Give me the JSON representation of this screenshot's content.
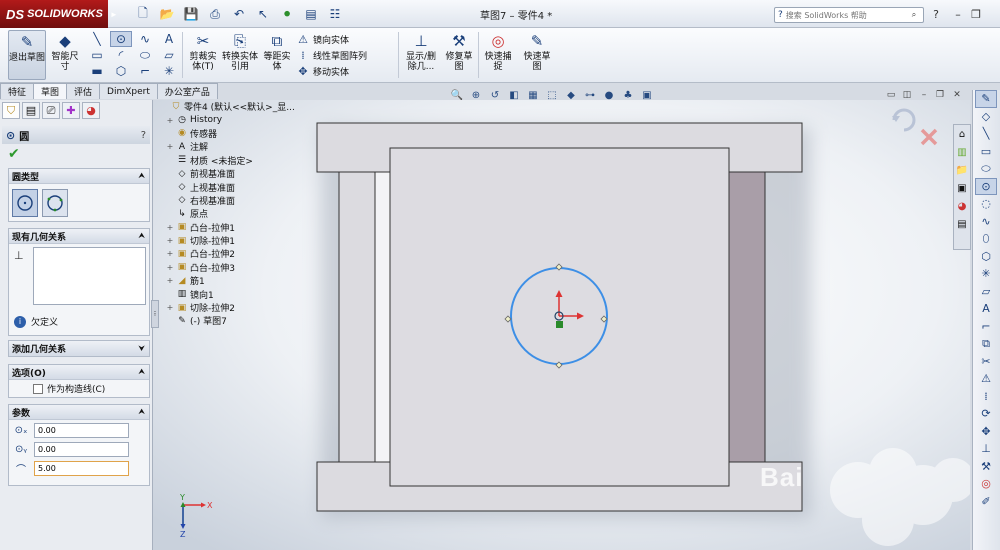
{
  "app": {
    "brand_mark": "DS",
    "name": "SOLIDWORKS",
    "doc_title": "草图7 – 零件4 *"
  },
  "search": {
    "placeholder": "搜索 SolidWorks 帮助"
  },
  "cmd": {
    "exit_sketch": "退出草图",
    "smart_dim": "智能尺寸",
    "trim": "剪裁实体(T)",
    "convert": "转换实体引用",
    "offset": "等距实体",
    "mirror": "镜向实体",
    "linear_pattern": "线性草图阵列",
    "move": "移动实体",
    "display_delete": "显示/删除几...",
    "repair": "修复草图",
    "quick_snaps": "快速捕捉",
    "rapid_sketch": "快速草图"
  },
  "tabs": [
    "特征",
    "草图",
    "评估",
    "DimXpert",
    "办公室产品"
  ],
  "active_tab": 1,
  "panel": {
    "title": "圆",
    "group_type": "圆类型",
    "group_existing": "现有几何关系",
    "status": "欠定义",
    "group_add": "添加几何关系",
    "group_options": "选项(O)",
    "construction": "作为构造线(C)",
    "group_params": "参数",
    "cx": "0.00",
    "cy": "0.00",
    "radius": "5.00"
  },
  "tree": [
    {
      "label": "零件4  (默认<<默认>_显...",
      "icon": "part-icon",
      "expand": ""
    },
    {
      "label": "History",
      "icon": "history-icon",
      "expand": "+"
    },
    {
      "label": "传感器",
      "icon": "sensor-icon",
      "expand": ""
    },
    {
      "label": "注解",
      "icon": "annotation-icon",
      "expand": "+"
    },
    {
      "label": "材质 <未指定>",
      "icon": "material-icon",
      "expand": ""
    },
    {
      "label": "前视基准面",
      "icon": "plane-icon",
      "expand": ""
    },
    {
      "label": "上视基准面",
      "icon": "plane-icon",
      "expand": ""
    },
    {
      "label": "右视基准面",
      "icon": "plane-icon",
      "expand": ""
    },
    {
      "label": "原点",
      "icon": "origin-icon",
      "expand": ""
    },
    {
      "label": "凸台-拉伸1",
      "icon": "boss-extrude-icon",
      "expand": "+"
    },
    {
      "label": "切除-拉伸1",
      "icon": "cut-extrude-icon",
      "expand": "+"
    },
    {
      "label": "凸台-拉伸2",
      "icon": "boss-extrude-icon",
      "expand": "+"
    },
    {
      "label": "凸台-拉伸3",
      "icon": "boss-extrude-icon",
      "expand": "+"
    },
    {
      "label": "筋1",
      "icon": "rib-icon",
      "expand": "+"
    },
    {
      "label": "镜向1",
      "icon": "mirror-icon",
      "expand": ""
    },
    {
      "label": "切除-拉伸2",
      "icon": "cut-extrude-icon",
      "expand": "+"
    },
    {
      "label": "(-) 草图7",
      "icon": "sketch-icon",
      "expand": ""
    }
  ],
  "triad": {
    "x": "X",
    "y": "Y",
    "z": "Z"
  },
  "watermark": "Bai",
  "colors": {
    "circle": "#3d8fe6",
    "accent": "#1a3f7a",
    "x_axis": "#d33",
    "y_axis": "#d33",
    "origin": "#2a8a2a"
  }
}
